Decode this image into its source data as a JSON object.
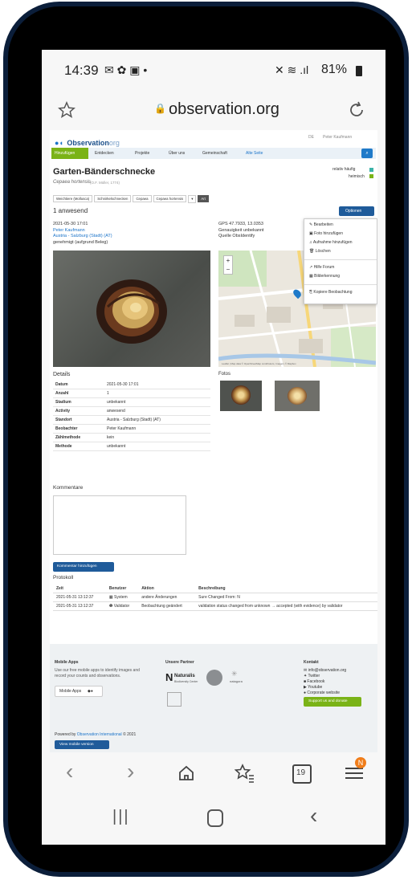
{
  "status_bar": {
    "time": "14:39",
    "notif_icons": "✉ ✿ ▣ •",
    "battery": "81%"
  },
  "url_bar": {
    "url": "observation.org"
  },
  "site": {
    "logo_text": "Observation",
    "logo_suffix": "org",
    "lang": "DE",
    "user": "Peter Kaufmann",
    "nav": [
      "Hinzufügen",
      "Entdecken",
      "Projekte",
      "Über uns",
      "Gemeinschaft"
    ],
    "nav_alt": "Alte Seite"
  },
  "species": {
    "title": "Garten-Bänderschnecke",
    "scientific": "Cepaea hortensis",
    "author": "(O.F. Müller, 1774)",
    "rarity": "relativ häufig",
    "status": "heimisch",
    "breadcrumb": [
      "Weichtiere (Mollusca)",
      "Schnirkelschnecken",
      "Cepaea",
      "Cepaea hortensis",
      "▾",
      "Art"
    ]
  },
  "observation": {
    "count_label": "1 anwesend",
    "options_label": "Optionen",
    "date": "2021-05-30 17:01",
    "observer": "Peter Kaufmann",
    "location": "Austria - Salzburg (Stadt) (AT)",
    "validation": "genehmigt (aufgrund Beleg)",
    "gps": "GPS 47.7933, 13.0353",
    "accuracy": "Genauigkeit unbekannt",
    "source": "Quelle ObsIdentify"
  },
  "menu": [
    "Bearbeiten",
    "Foto hinzufügen",
    "Aufnahme hinzufügen",
    "Löschen",
    "Hilfe Forum",
    "Bilderkennung",
    "Kopiere Beobachtung"
  ],
  "map": {
    "attribution": "Leaflet | Map data © OpenStreetMap contributors, Imagery © Mapbox",
    "fotos_label": "Fotos"
  },
  "details": {
    "title": "Details",
    "rows": [
      [
        "Datum",
        "2021-05-30 17:01"
      ],
      [
        "Anzahl",
        "1"
      ],
      [
        "Stadium",
        "unbekannt"
      ],
      [
        "Activity",
        "anwesend"
      ],
      [
        "Standort",
        "Austria - Salzburg (Stadt) (AT)"
      ],
      [
        "Beobachter",
        "Peter Kaufmann"
      ],
      [
        "Zählmethode",
        "kein"
      ],
      [
        "Methode",
        "unbekannt"
      ]
    ]
  },
  "comments": {
    "title": "Kommentare",
    "button": "Kommentar hinzufügen"
  },
  "protocol": {
    "title": "Protokoll",
    "headers": [
      "Zeit",
      "Benutzer",
      "Aktion",
      "Beschreibung"
    ],
    "rows": [
      [
        "2021-05-31 13:12:37",
        "System",
        "andere Änderungen",
        "Sure Changed From: N"
      ],
      [
        "2021-05-31 13:12:37",
        "Validator",
        "Beobachtung geändert",
        "validation status changed from unknown → accepted (with evidence) by validator"
      ]
    ]
  },
  "footer": {
    "mobile_title": "Mobile Apps",
    "mobile_text": "Use our free mobile apps to identify images and record your counts and observations.",
    "mobile_btn": "Mobile Apps",
    "partner_title": "Unsere Partner",
    "partner_naturalis": "Naturalis",
    "partner_naturalis_sub": "Biodiversity Center",
    "partner_natagora": "natagora",
    "contact_title": "Kontakt",
    "contacts": [
      "info@observation.org",
      "Twitter",
      "Facebook",
      "Youtube",
      "Corporate website"
    ],
    "support_btn": "Support us and donate",
    "powered_prefix": "Powered by",
    "powered_link": "Observation International",
    "powered_year": "© 2021",
    "view_mobile": "View mobile version"
  },
  "browser_nav": {
    "tabs_count": "19",
    "badge": "N"
  },
  "colors": {
    "accent_green": "#7ab317",
    "link_blue": "#1a73c9",
    "options_blue": "#1f5b9a",
    "footer_bg": "#eef1f3"
  }
}
